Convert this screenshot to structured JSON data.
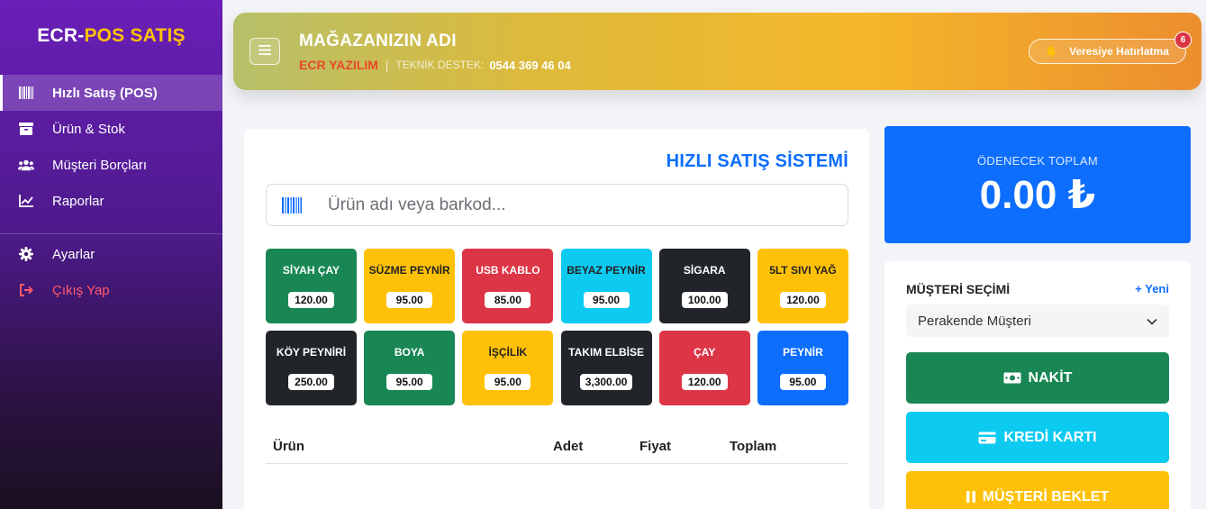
{
  "sidebar": {
    "brand_part1": "ECR-",
    "brand_part2": "POS SATIŞ",
    "items": [
      {
        "label": "Hızlı Satış (POS)",
        "icon": "barcode-icon"
      },
      {
        "label": "Ürün & Stok",
        "icon": "box-icon"
      },
      {
        "label": "Müşteri Borçları",
        "icon": "users-icon"
      },
      {
        "label": "Raporlar",
        "icon": "chart-line-icon"
      },
      {
        "label": "Ayarlar",
        "icon": "gear-icon"
      },
      {
        "label": "Çıkış Yap",
        "icon": "logout-icon"
      }
    ]
  },
  "header": {
    "shop_name": "MAĞAZANIZIN ADI",
    "company": "ECR YAZILIM",
    "separator": "|",
    "support_label": "TEKNİK DESTEK:",
    "support_phone": "0544 369 46 04",
    "reminder_label": "Veresiye Hatırlatma",
    "reminder_count": "6"
  },
  "pos": {
    "title": "HIZLI SATIŞ SİSTEMİ",
    "search_placeholder": "Ürün adı veya barkod...",
    "products": [
      {
        "name": "SİYAH ÇAY",
        "price": "120.00",
        "color": "#198754"
      },
      {
        "name": "SÜZME PEYNİR",
        "price": "95.00",
        "color": "#ffc107"
      },
      {
        "name": "USB KABLO",
        "price": "85.00",
        "color": "#dc3545"
      },
      {
        "name": "BEYAZ PEYNİR",
        "price": "95.00",
        "color": "#0dcaf0"
      },
      {
        "name": "SİGARA",
        "price": "100.00",
        "color": "#212529"
      },
      {
        "name": "5LT SIVI YAĞ",
        "price": "120.00",
        "color": "#ffc107"
      },
      {
        "name": "KÖY PEYNİRİ",
        "price": "250.00",
        "color": "#212529"
      },
      {
        "name": "BOYA",
        "price": "95.00",
        "color": "#198754"
      },
      {
        "name": "İŞÇİLİK",
        "price": "95.00",
        "color": "#ffc107"
      },
      {
        "name": "TAKIM ELBİSE",
        "price": "3,300.00",
        "color": "#212529"
      },
      {
        "name": "ÇAY",
        "price": "120.00",
        "color": "#dc3545"
      },
      {
        "name": "PEYNİR",
        "price": "95.00",
        "color": "#0d6efd"
      }
    ],
    "table_headers": [
      "Ürün",
      "Adet",
      "Fiyat",
      "Toplam"
    ]
  },
  "total": {
    "label": "ÖDENECEK TOPLAM",
    "amount": "0.00 ₺"
  },
  "customer": {
    "title": "MÜŞTERİ SEÇİMİ",
    "new_label": "+ Yeni",
    "selected": "Perakende Müşteri",
    "buttons": {
      "cash": "NAKİT",
      "card": "KREDİ KARTI",
      "hold": "MÜŞTERİ BEKLET"
    }
  }
}
